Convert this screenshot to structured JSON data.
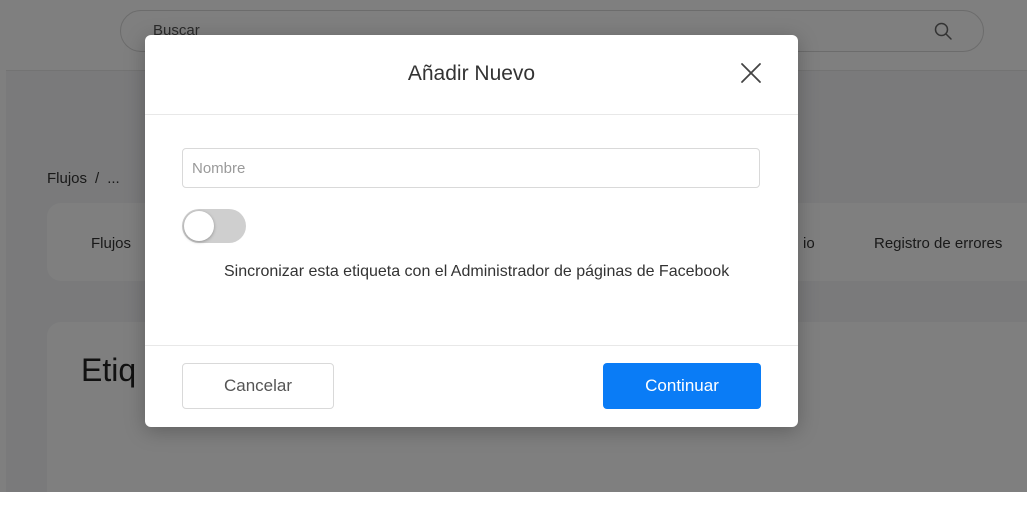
{
  "search": {
    "placeholder": "Buscar"
  },
  "breadcrumb": {
    "root": "Flujos",
    "separator": "/",
    "current": "..."
  },
  "tabs": [
    {
      "label": "Flujos"
    },
    {
      "label": "io"
    },
    {
      "label": "Registro de errores"
    }
  ],
  "main": {
    "title": "Etiq"
  },
  "modal": {
    "title": "Añadir Nuevo",
    "name_placeholder": "Nombre",
    "name_value": "",
    "toggle_on": false,
    "sync_text": "Sincronizar esta etiqueta con el Administrador de páginas de Facebook",
    "cancel_label": "Cancelar",
    "continue_label": "Continuar"
  },
  "colors": {
    "primary": "#0a7cf6",
    "overlay": "rgba(0,0,0,0.5)",
    "toggle_off": "#cfcfcf"
  },
  "icons": {
    "search": "search-icon",
    "close": "close-icon"
  }
}
